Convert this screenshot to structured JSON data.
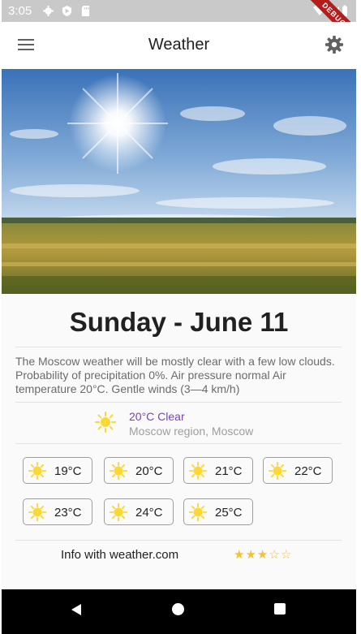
{
  "status_bar": {
    "time": "3:05",
    "debug_label": "DEBUG"
  },
  "app_bar": {
    "title": "Weather"
  },
  "day": {
    "title": "Sunday - June 11"
  },
  "description": "The Moscow weather will be mostly clear with a few low clouds. Probability of precipitation 0%. Air pressure normal Air temperature  20°C. Gentle winds (3—4 km/h)",
  "current": {
    "condition": "20°C Clear",
    "location": "Moscow region, Moscow",
    "icon": "sun-icon"
  },
  "forecast": [
    {
      "temp": "19°C",
      "icon": "sun-icon"
    },
    {
      "temp": "20°C",
      "icon": "sun-icon"
    },
    {
      "temp": "21°C",
      "icon": "sun-icon"
    },
    {
      "temp": "22°C",
      "icon": "sun-icon"
    },
    {
      "temp": "23°C",
      "icon": "sun-icon"
    },
    {
      "temp": "24°C",
      "icon": "sun-icon"
    },
    {
      "temp": "25°C",
      "icon": "sun-icon"
    }
  ],
  "footer": {
    "info": "Info with weather.com",
    "rating": 3,
    "rating_max": 5
  },
  "colors": {
    "accent": "#7b3fbf",
    "star": "#fbc02d",
    "sun": "#fdd835"
  }
}
